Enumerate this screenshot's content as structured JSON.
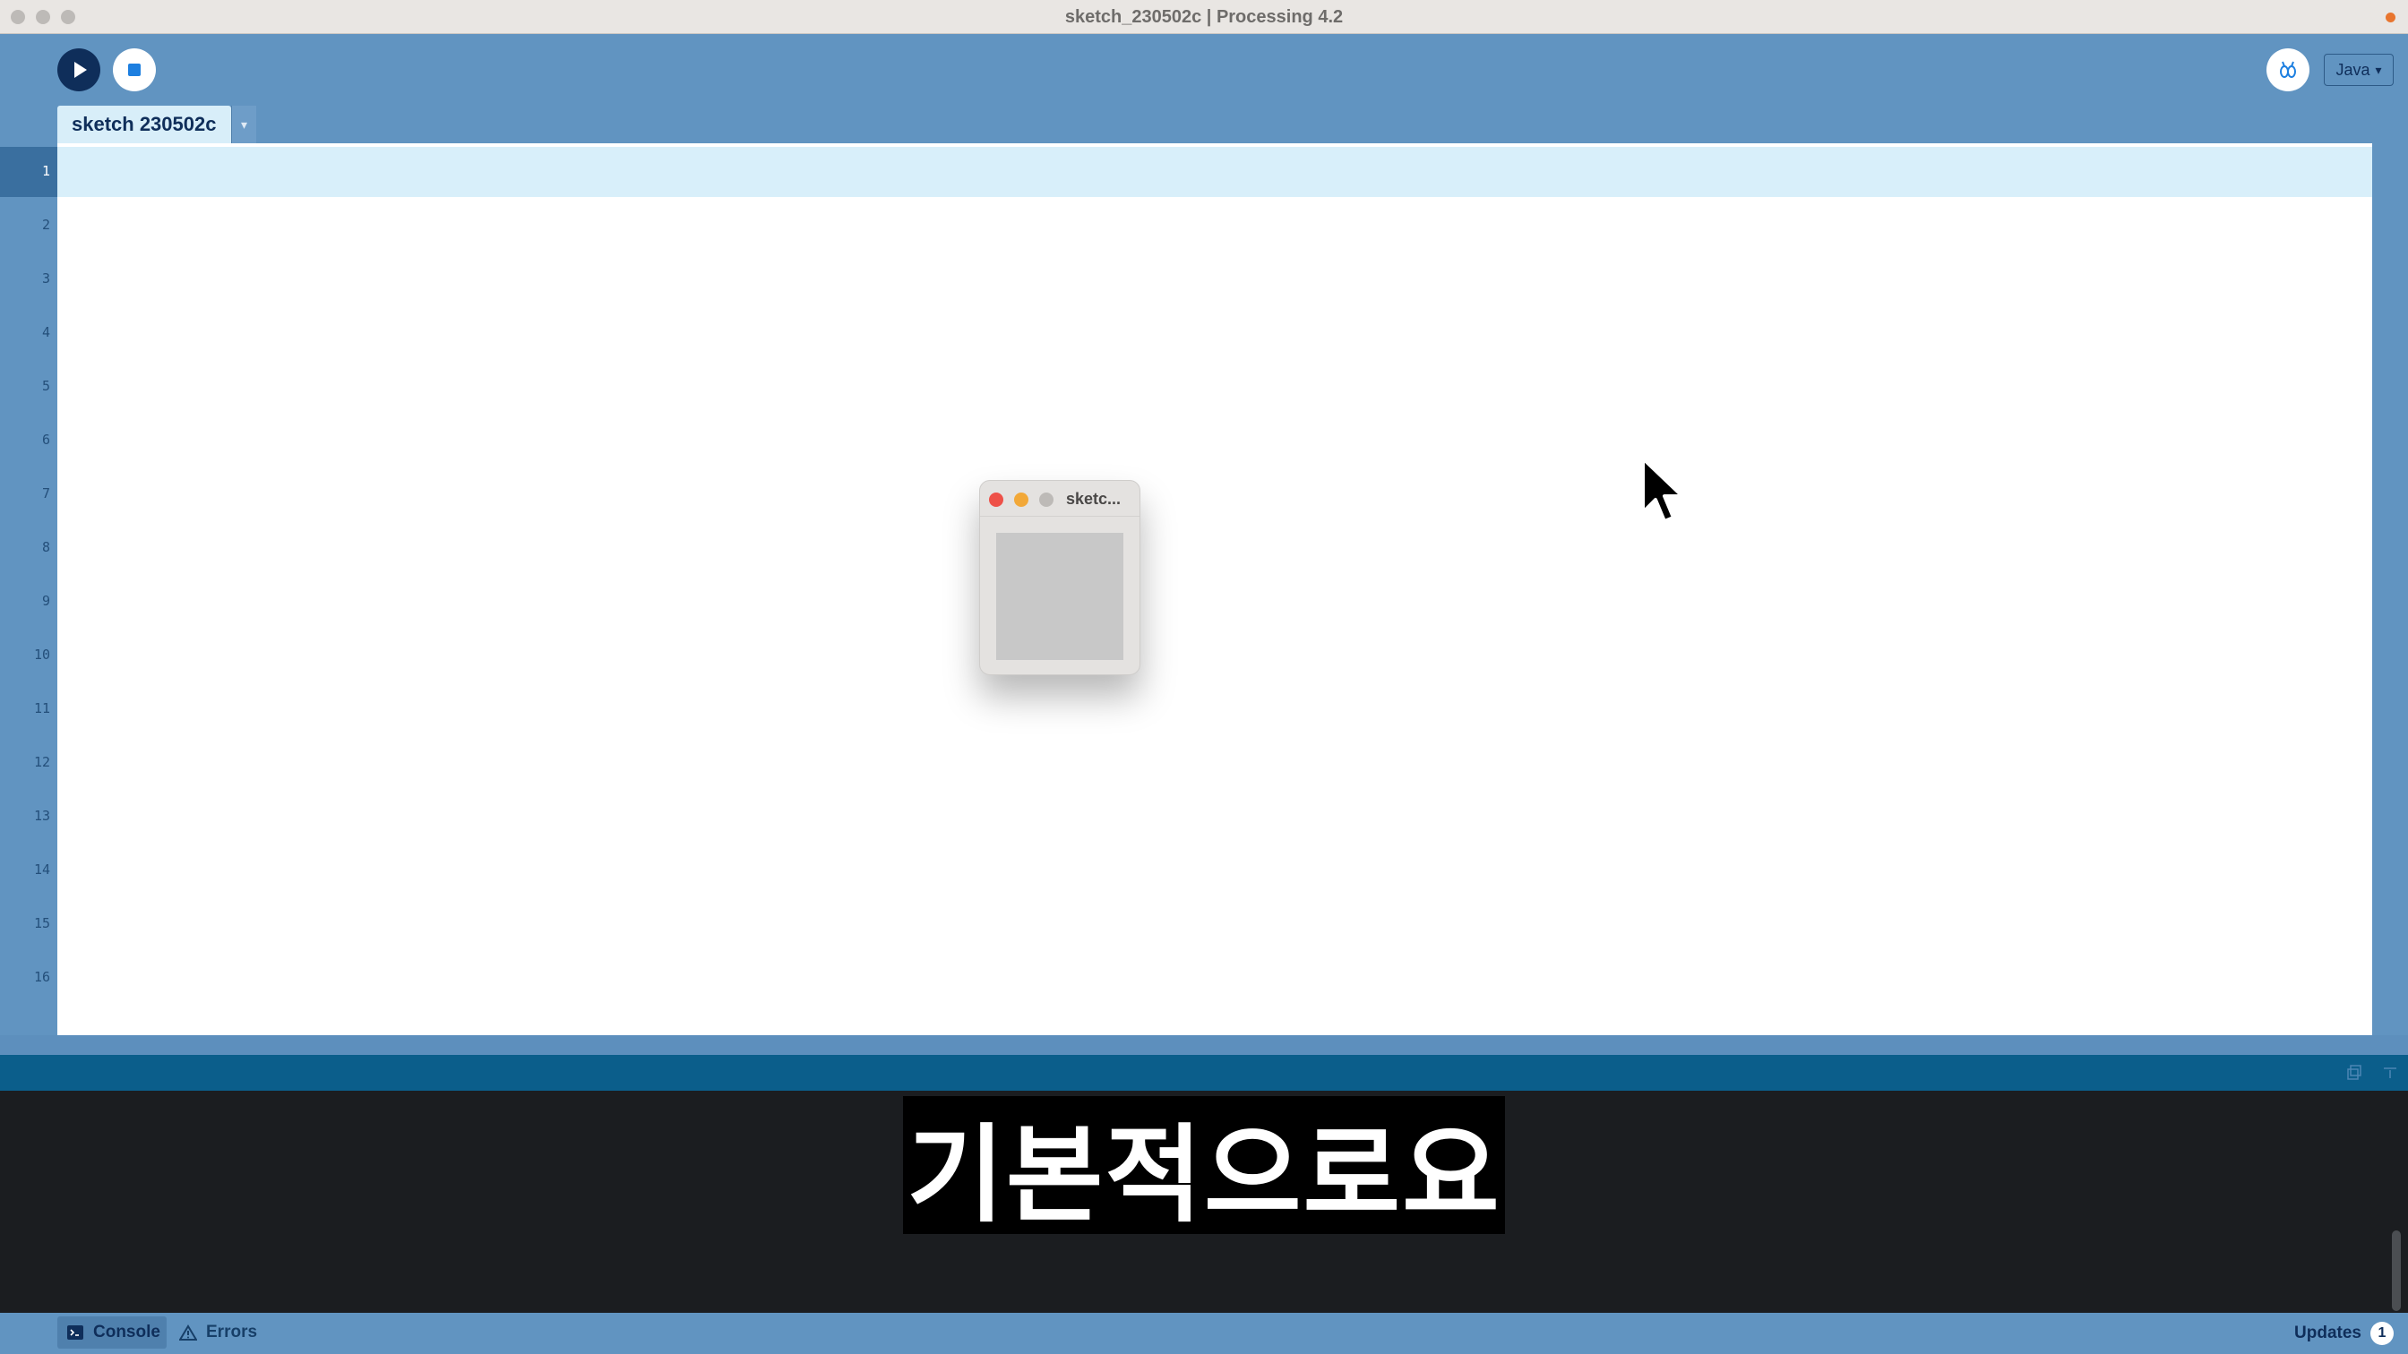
{
  "window": {
    "title": "sketch_230502c | Processing 4.2"
  },
  "toolbar": {
    "run_label": "Run",
    "stop_label": "Stop",
    "mode_label": "Java",
    "mode_caret": "▾"
  },
  "tabs": [
    {
      "label": "sketch 230502c"
    }
  ],
  "tab_menu_glyph": "▾",
  "editor": {
    "line_numbers": [
      "1",
      "2",
      "3",
      "4",
      "5",
      "6",
      "7",
      "8",
      "9",
      "10",
      "11",
      "12",
      "13",
      "14",
      "15",
      "16"
    ],
    "current_line": "1"
  },
  "sketch_window": {
    "title": "sketc...",
    "canvas_color": "#c8c8c8"
  },
  "console": {
    "subtitle": "기본적으로요"
  },
  "statusbar": {
    "console_label": "Console",
    "errors_label": "Errors",
    "updates_label": "Updates",
    "updates_count": "1"
  },
  "colors": {
    "frame_blue": "#6194c1",
    "run_navy": "#0f2e5a",
    "current_line": "#d8effa",
    "console_bg": "#1b1d20",
    "console_header": "#0b5e8b",
    "title_dot_orange": "#e8752e"
  },
  "icons": {
    "run": "play-icon",
    "stop": "stop-square-icon",
    "debug": "debug-bug-icon",
    "console": "terminal-icon",
    "errors": "warning-triangle-icon",
    "copy": "copy-icon",
    "clear": "clear-console-icon"
  }
}
